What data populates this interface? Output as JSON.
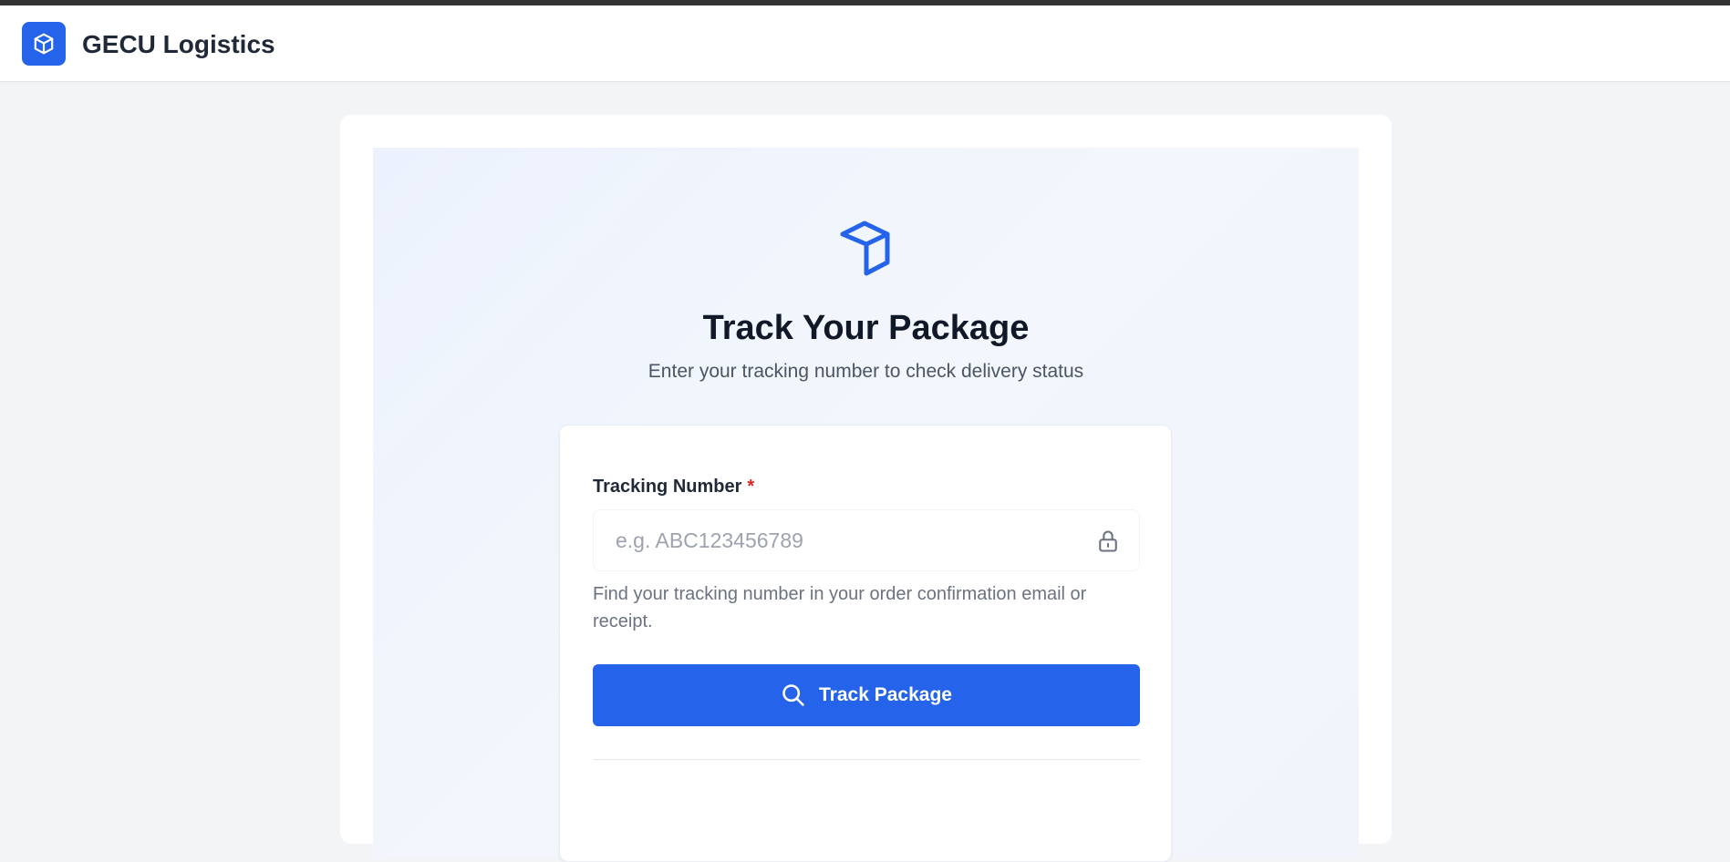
{
  "header": {
    "brand": "GECU Logistics",
    "logo_icon": "cube-icon"
  },
  "hero": {
    "icon": "package-icon",
    "title": "Track Your Package",
    "subtitle": "Enter your tracking number to check delivery status"
  },
  "form": {
    "label": "Tracking Number",
    "required_marker": "*",
    "input_value": "",
    "placeholder": "e.g. ABC123456789",
    "input_icon": "lock-icon",
    "helper": "Find your tracking number in your order confirmation email or receipt.",
    "button_label": "Track Package",
    "button_icon": "search-icon"
  },
  "colors": {
    "accent": "#2563eb",
    "required": "#dc2626",
    "page_bg": "#f3f4f6"
  }
}
